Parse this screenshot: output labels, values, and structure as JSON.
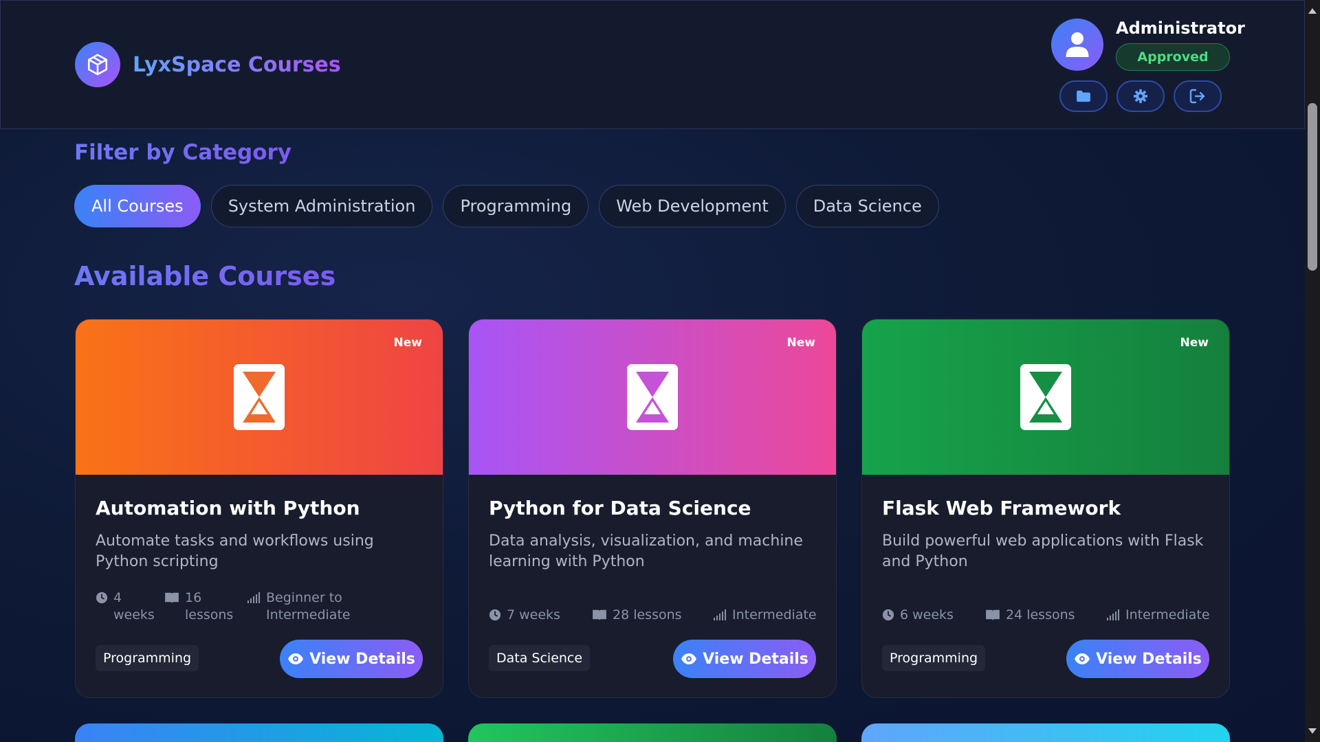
{
  "brand": {
    "title": "LyxSpace Courses",
    "logo_icon": "cube-icon"
  },
  "user": {
    "name": "Administrator",
    "status": "Approved",
    "avatar_icon": "user-icon",
    "actions": [
      {
        "icon": "folder-icon"
      },
      {
        "icon": "gear-icon"
      },
      {
        "icon": "logout-icon"
      }
    ]
  },
  "filter": {
    "title": "Filter by Category",
    "categories": [
      "All Courses",
      "System Administration",
      "Programming",
      "Web Development",
      "Data Science"
    ],
    "active": "All Courses"
  },
  "courses_section": {
    "title": "Available Courses",
    "courses": [
      {
        "badge": "New",
        "title": "Automation with Python",
        "description": "Automate tasks and workflows using Python scripting",
        "duration": "4 weeks",
        "lessons": "16 lessons",
        "level": "Beginner to Intermediate",
        "category": "Programming",
        "button": "View Details",
        "banner_colors": [
          "#f97316",
          "#ef4444"
        ]
      },
      {
        "badge": "New",
        "title": "Python for Data Science",
        "description": "Data analysis, visualization, and machine learning with Python",
        "duration": "7 weeks",
        "lessons": "28 lessons",
        "level": "Intermediate",
        "category": "Data Science",
        "button": "View Details",
        "banner_colors": [
          "#a855f7",
          "#ec4899"
        ]
      },
      {
        "badge": "New",
        "title": "Flask Web Framework",
        "description": "Build powerful web applications with Flask and Python",
        "duration": "6 weeks",
        "lessons": "24 lessons",
        "level": "Intermediate",
        "category": "Programming",
        "button": "View Details",
        "banner_colors": [
          "#16a34a",
          "#15803d"
        ]
      }
    ]
  },
  "colors": {
    "accent_start": "#3b82f6",
    "accent_end": "#8b5cf6",
    "approved": "#4ade80"
  }
}
